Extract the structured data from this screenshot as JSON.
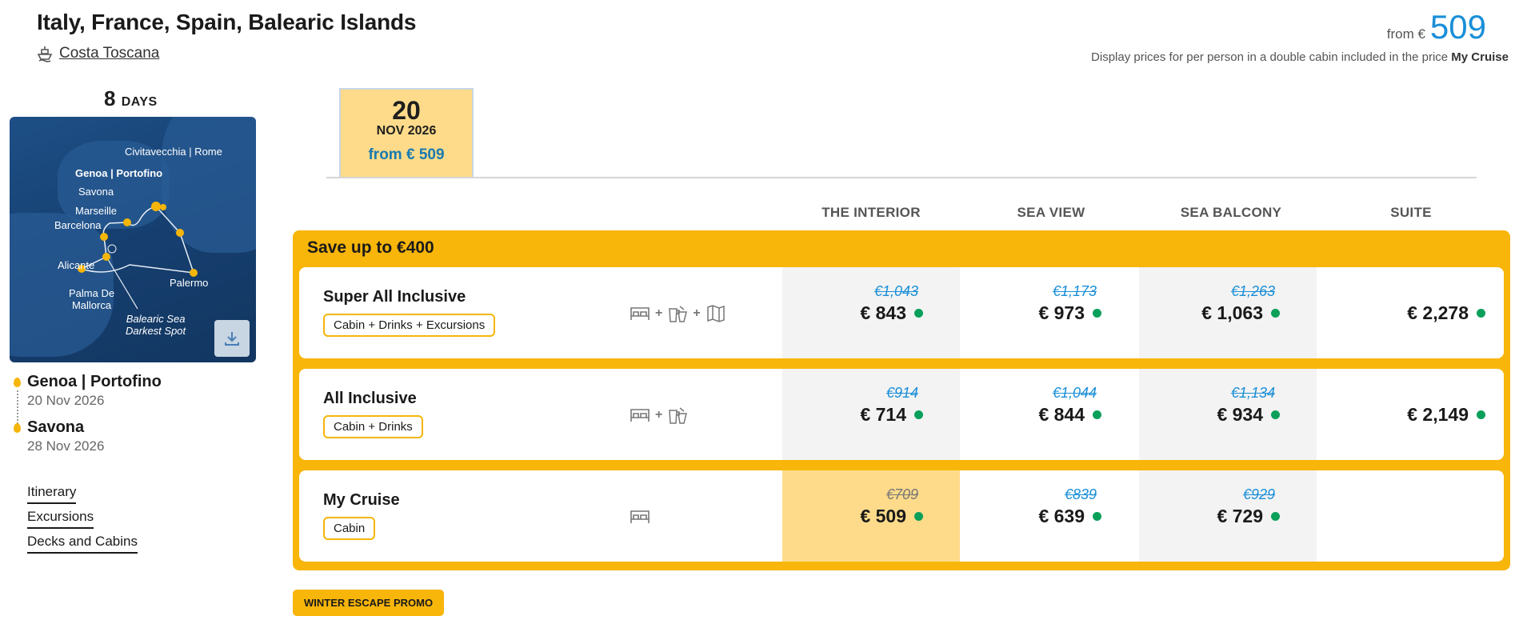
{
  "header": {
    "title": "Italy, France, Spain, Balearic Islands",
    "ship_name": "Costa Toscana",
    "from_label": "from €",
    "from_value": "509",
    "price_note_prefix": "Display prices for per person in a double cabin included in the price",
    "price_note_bold": "My Cruise"
  },
  "itinerary": {
    "days_number": "8",
    "days_label": "DAYS",
    "map_labels": {
      "civitavecchia": "Civitavecchia | Rome",
      "genoa": "Genoa | Portofino",
      "savona": "Savona",
      "marseille": "Marseille",
      "barcelona": "Barcelona",
      "alicante": "Alicante",
      "palermo": "Palermo",
      "palma_1": "Palma De",
      "palma_2": "Mallorca",
      "balearic_1": "Balearic Sea",
      "balearic_2": "Darkest Spot"
    },
    "departure_port": "Genoa | Portofino",
    "departure_date": "20 Nov 2026",
    "arrival_port": "Savona",
    "arrival_date": "28 Nov 2026",
    "links": [
      "Itinerary",
      "Excursions",
      "Decks and Cabins"
    ]
  },
  "date_tab": {
    "day": "20",
    "month": "NOV 2026",
    "price": "from € 509"
  },
  "columns": [
    "THE INTERIOR",
    "SEA VIEW",
    "SEA BALCONY",
    "SUITE"
  ],
  "save_label": "Save up to €400",
  "fares": [
    {
      "name": "Super All Inclusive",
      "tag": "Cabin + Drinks + Excursions",
      "prices": [
        {
          "old": "€1,043",
          "new": "€ 843"
        },
        {
          "old": "€1,173",
          "new": "€ 973"
        },
        {
          "old": "€1,263",
          "new": "€ 1,063"
        },
        {
          "old": "",
          "new": "€ 2,278"
        }
      ]
    },
    {
      "name": "All Inclusive",
      "tag": "Cabin + Drinks",
      "prices": [
        {
          "old": "€914",
          "new": "€ 714"
        },
        {
          "old": "€1,044",
          "new": "€ 844"
        },
        {
          "old": "€1,134",
          "new": "€ 934"
        },
        {
          "old": "",
          "new": "€ 2,149"
        }
      ]
    },
    {
      "name": "My Cruise",
      "tag": "Cabin",
      "prices": [
        {
          "old": "€709",
          "new": "€ 509"
        },
        {
          "old": "€839",
          "new": "€ 639"
        },
        {
          "old": "€929",
          "new": "€ 729"
        }
      ]
    }
  ],
  "icons": {
    "plus": "+"
  },
  "promo_label": "WINTER ESCAPE PROMO",
  "colors": {
    "accent": "#f8b50a",
    "tab_bg": "#fddb8a",
    "price_blue": "#1a8fd8",
    "availability_green": "#0aa05a",
    "column_shade": "#f3f3f3"
  }
}
